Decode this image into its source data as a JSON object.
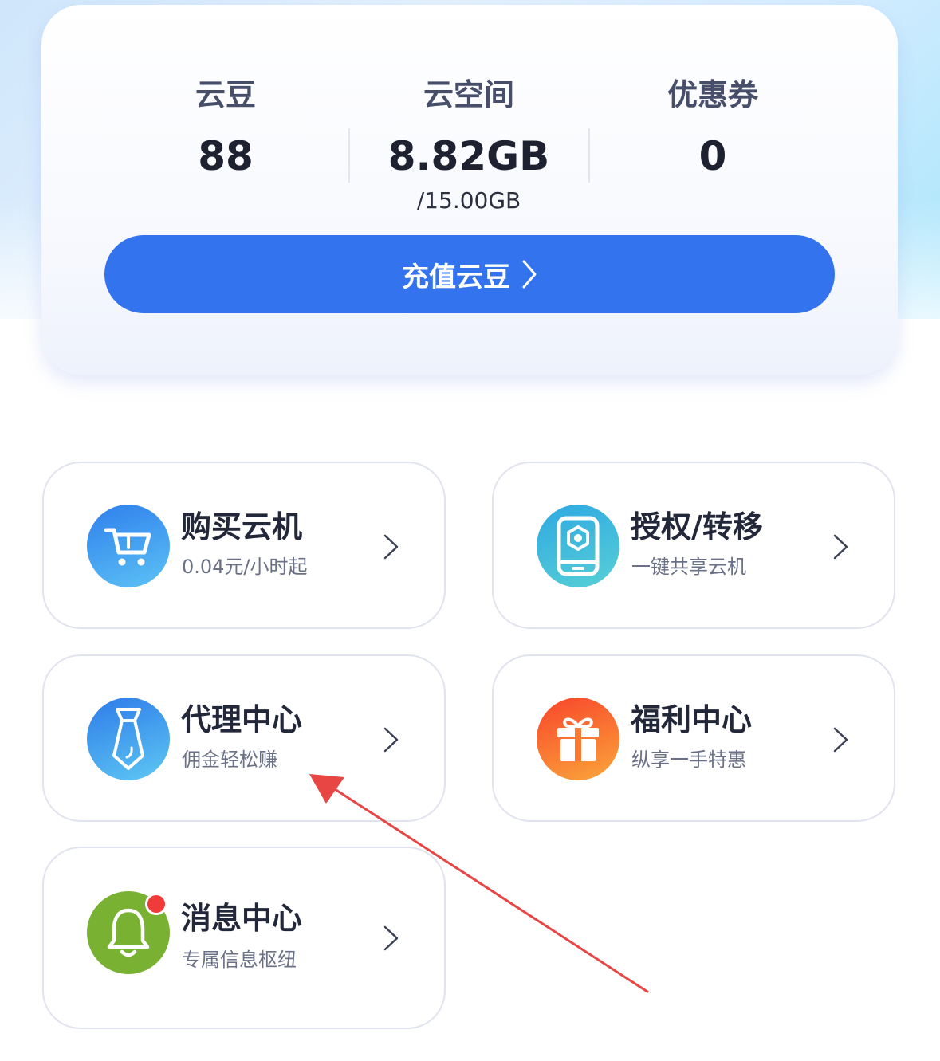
{
  "balance": {
    "beans": {
      "label": "云豆",
      "value": "88"
    },
    "space": {
      "label": "云空间",
      "value": "8.82GB",
      "total": "/15.00GB"
    },
    "coupons": {
      "label": "优惠券",
      "value": "0"
    },
    "recharge_label": "充值云豆"
  },
  "features": [
    {
      "title": "购买云机",
      "subtitle": "0.04元/小时起",
      "icon": "shopping-cart-icon"
    },
    {
      "title": "授权/转移",
      "subtitle": "一键共享云机",
      "icon": "phone-device-icon"
    },
    {
      "title": "代理中心",
      "subtitle": "佣金轻松赚",
      "icon": "necktie-icon"
    },
    {
      "title": "福利中心",
      "subtitle": "纵享一手特惠",
      "icon": "gift-icon"
    },
    {
      "title": "消息中心",
      "subtitle": "专属信息枢纽",
      "icon": "bell-icon",
      "has_unread_badge": true
    }
  ],
  "colors": {
    "primary_button": "#3373ee",
    "cart_icon": "#3d8ff0",
    "device_icon": "#35b8d8",
    "agent_icon": "#3e8cf0",
    "gift_icon": "#f86a2c",
    "bell_icon": "#79b233",
    "badge": "#ef3b3a",
    "annotation_arrow": "#e84545"
  }
}
